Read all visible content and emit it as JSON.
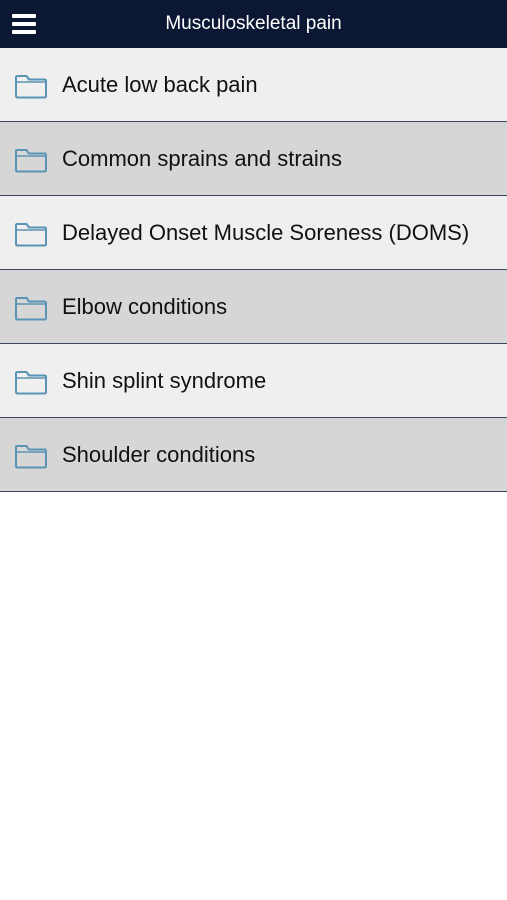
{
  "header": {
    "title": "Musculoskeletal pain",
    "menu_icon": "hamburger-menu-icon"
  },
  "list": {
    "item_icon": "folder-icon",
    "colors": {
      "row_light": "#efefef",
      "row_dark": "#d6d6d6",
      "folder_stroke": "#5a93b4",
      "header_bg": "#0c1733"
    },
    "items": [
      {
        "label": "Acute low back pain"
      },
      {
        "label": "Common sprains and strains"
      },
      {
        "label": "Delayed Onset Muscle Soreness (DOMS)"
      },
      {
        "label": "Elbow conditions"
      },
      {
        "label": "Shin splint syndrome"
      },
      {
        "label": "Shoulder conditions"
      }
    ]
  }
}
